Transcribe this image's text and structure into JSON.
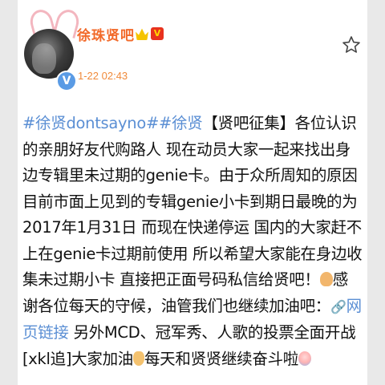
{
  "user": {
    "name": "徐珠贤吧",
    "post_time": "1-22 02:43",
    "verified_glyph": "V"
  },
  "post": {
    "tag1": "#徐贤dontsayno#",
    "tag2": "#徐贤",
    "text1": "【贤吧征集】各位认识的亲朋好友代购路人 现在动员大家一起来找出身边专辑里未过期的genie卡。由于众所周知的原因 目前市面上见到的专辑genie小卡到期日最晚的为2017年1月31日 而现在快递停运 国内的大家赶不上在genie卡过期前使用 所以希望大家能在身边收集未过期小卡 直接把正面号码私信给贤吧！",
    "text2": "感谢各位每天的守候，油管我们也继续加油吧：",
    "link_label": "网页链接",
    "text3": " 另外MCD、冠军秀、人歌的投票全面开战[xkl追]大家加油",
    "text4": "每天和贤贤继续奋斗啦"
  },
  "icons": {
    "star": "star-outline-icon",
    "link": "link-icon",
    "crown": "crown-badge-icon",
    "vip": "vip-badge-icon"
  },
  "colors": {
    "name": "#f26a2a",
    "time": "#f08a3a",
    "link": "#5b8fd4",
    "verified": "#5a9be5"
  }
}
